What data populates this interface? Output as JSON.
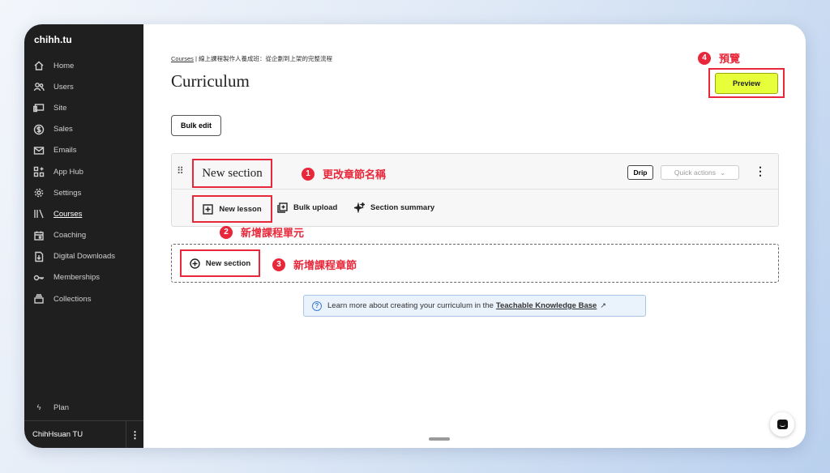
{
  "sidebar": {
    "brand": "chihh.tu",
    "items": [
      {
        "label": "Home",
        "icon": "home-icon",
        "active": false
      },
      {
        "label": "Users",
        "icon": "users-icon",
        "active": false
      },
      {
        "label": "Site",
        "icon": "site-icon",
        "active": false
      },
      {
        "label": "Sales",
        "icon": "dollar-icon",
        "active": false
      },
      {
        "label": "Emails",
        "icon": "mail-icon",
        "active": false
      },
      {
        "label": "App Hub",
        "icon": "app-hub-icon",
        "active": false
      },
      {
        "label": "Settings",
        "icon": "gear-icon",
        "active": false
      },
      {
        "label": "Courses",
        "icon": "books-icon",
        "active": true
      },
      {
        "label": "Coaching",
        "icon": "calendar-icon",
        "active": false
      },
      {
        "label": "Digital Downloads",
        "icon": "download-icon",
        "active": false
      },
      {
        "label": "Memberships",
        "icon": "key-icon",
        "active": false
      },
      {
        "label": "Collections",
        "icon": "collections-icon",
        "active": false
      }
    ],
    "plan_label": "Plan",
    "user_name": "ChihHsuan TU"
  },
  "main": {
    "breadcrumb_link": "Courses",
    "breadcrumb_rest": " | 線上課程製作人養成班：從企劃到上架的完整流程",
    "title": "Curriculum",
    "preview_label": "Preview",
    "bulk_edit_label": "Bulk edit",
    "section": {
      "title": "New section",
      "drip_label": "Drip",
      "quick_actions_label": "Quick actions",
      "new_lesson_label": "New lesson",
      "bulk_upload_label": "Bulk upload",
      "section_summary_label": "Section summary"
    },
    "new_section_label": "New section",
    "info": {
      "text": "Learn more about creating your curriculum in the",
      "link": "Teachable Knowledge Base"
    }
  },
  "annotations": {
    "a1": {
      "num": "1",
      "text": "更改章節名稱"
    },
    "a2": {
      "num": "2",
      "text": "新增課程單元"
    },
    "a3": {
      "num": "3",
      "text": "新增課程章節"
    },
    "a4": {
      "num": "4",
      "text": "預覽"
    }
  },
  "colors": {
    "annotation": "#e8283a",
    "preview_button": "#e6ff3a",
    "sidebar_bg": "#1f1f1f"
  }
}
